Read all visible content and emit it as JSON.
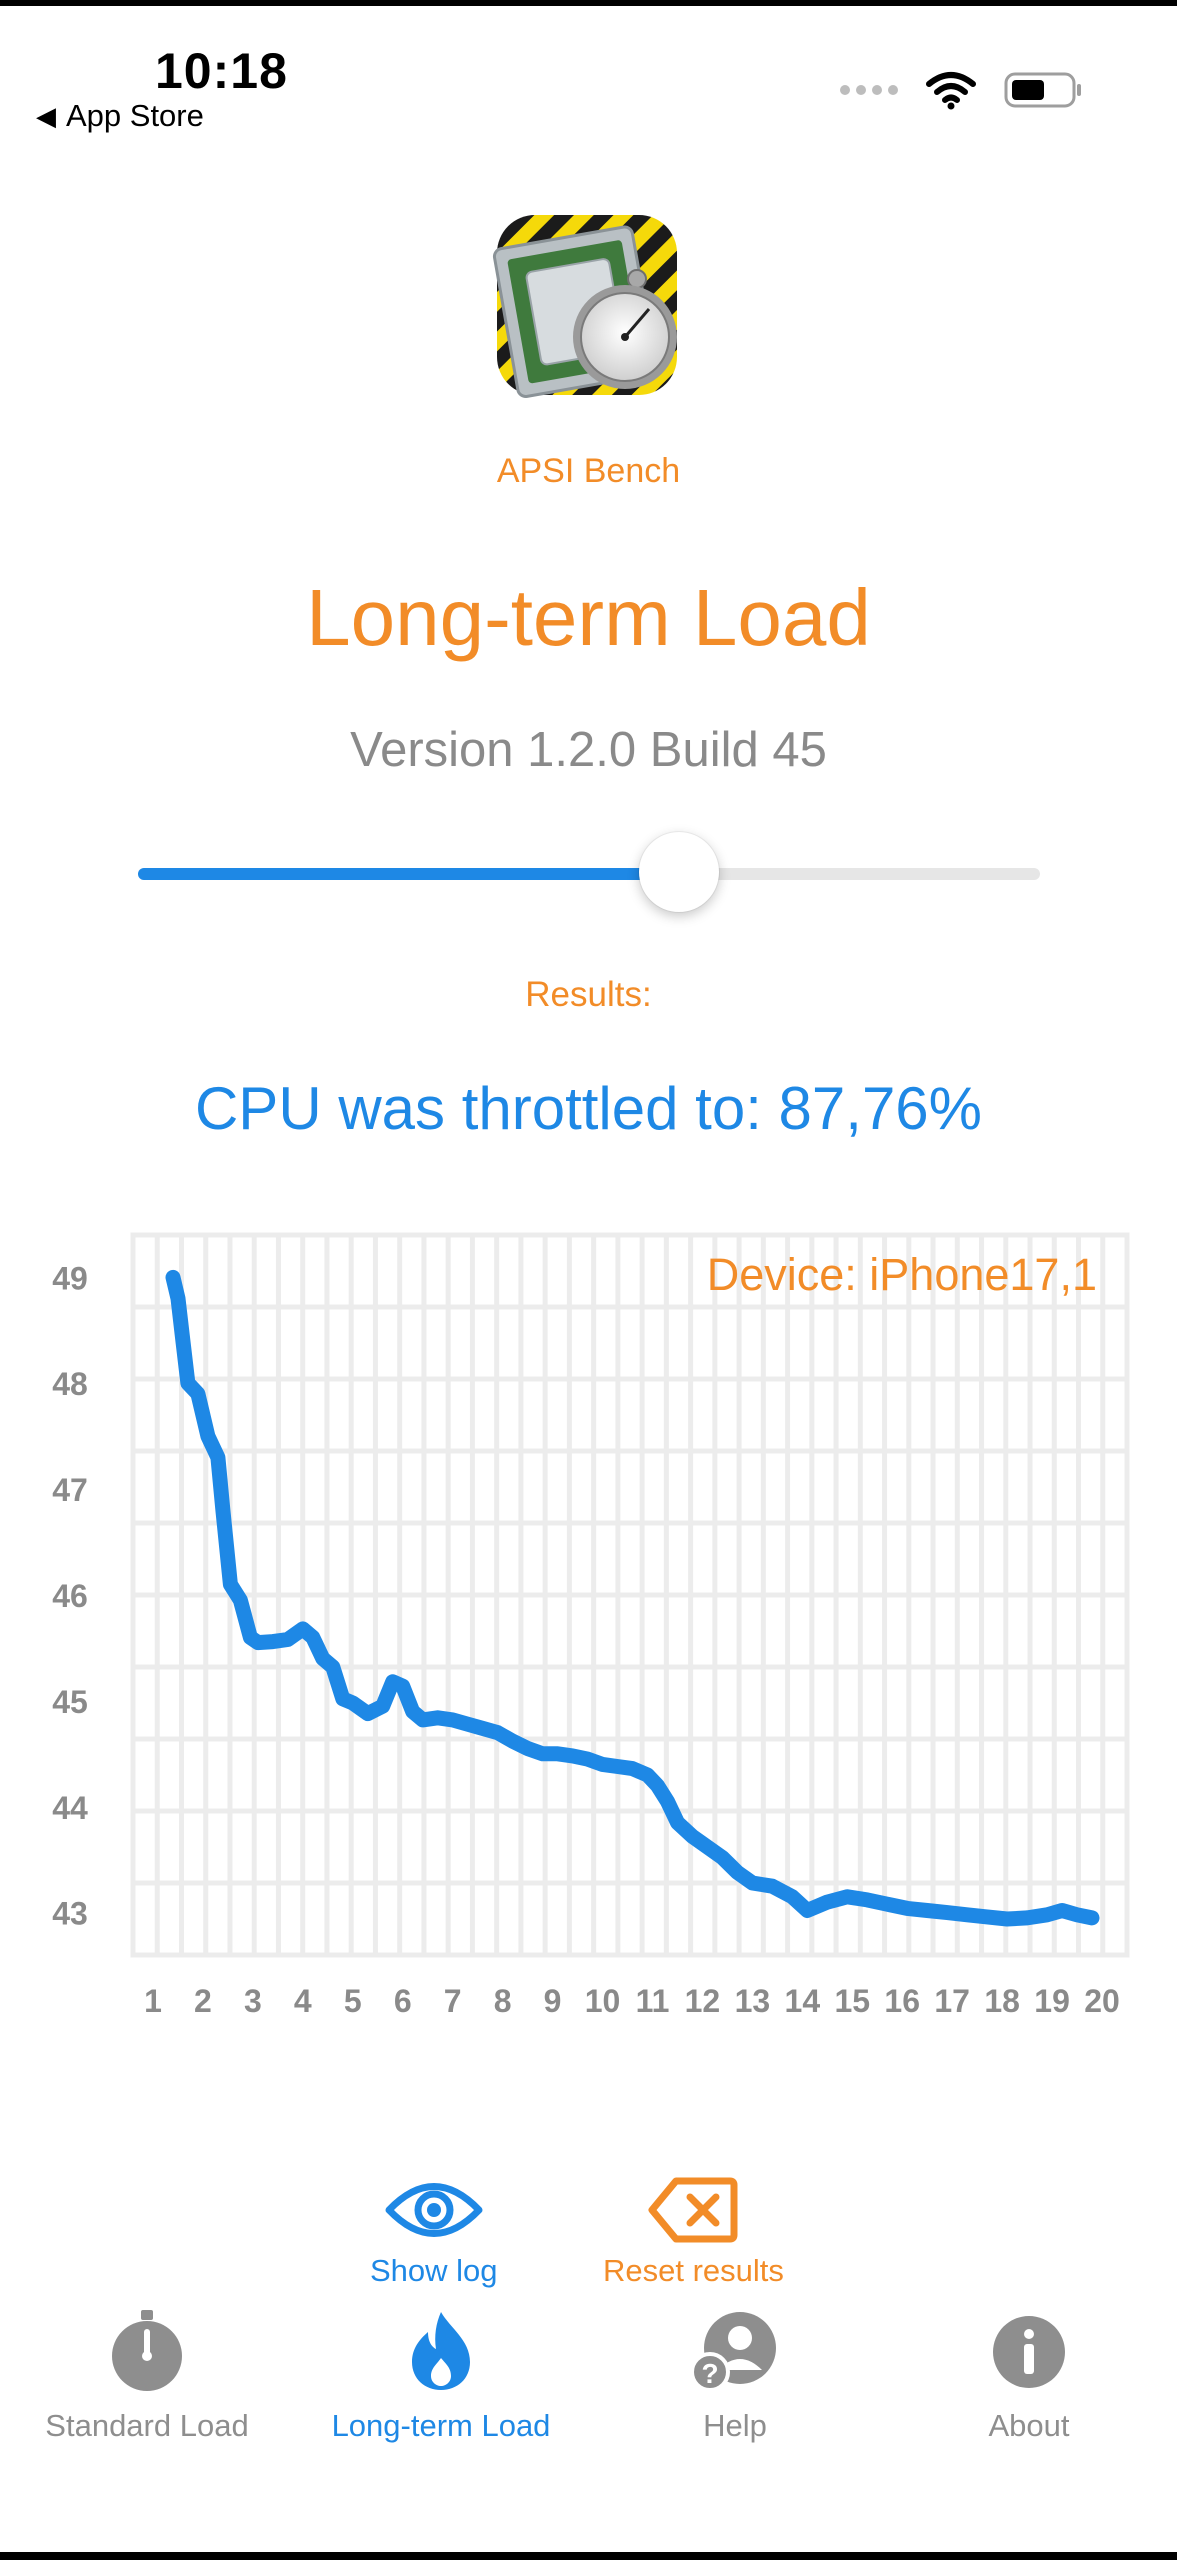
{
  "status": {
    "time": "10:18",
    "back_label": "App Store"
  },
  "app": {
    "name": "APSI Bench"
  },
  "page": {
    "title": "Long-term Load",
    "version": "Version 1.2.0 Build 45"
  },
  "slider": {
    "fraction": 0.6
  },
  "results": {
    "label": "Results:",
    "throttle_text": "CPU was throttled to: 87,76%"
  },
  "chart_data": {
    "type": "line",
    "annotation": "Device: iPhone17,1",
    "x_ticks": [
      "1",
      "2",
      "3",
      "4",
      "5",
      "6",
      "7",
      "8",
      "9",
      "10",
      "11",
      "12",
      "13",
      "14",
      "15",
      "16",
      "17",
      "18",
      "19",
      "20"
    ],
    "y_ticks": [
      "49",
      "48",
      "47",
      "46",
      "45",
      "44",
      "43"
    ],
    "xlim": [
      0.6,
      20.5
    ],
    "ylim": [
      42.6,
      49.4
    ],
    "grid": true,
    "line_color": "#1E88E5",
    "points": [
      [
        1.4,
        49.0
      ],
      [
        1.5,
        48.8
      ],
      [
        1.6,
        48.4
      ],
      [
        1.7,
        48.0
      ],
      [
        1.9,
        47.9
      ],
      [
        2.1,
        47.5
      ],
      [
        2.3,
        47.3
      ],
      [
        2.4,
        46.8
      ],
      [
        2.55,
        46.1
      ],
      [
        2.75,
        45.95
      ],
      [
        2.95,
        45.6
      ],
      [
        3.1,
        45.55
      ],
      [
        3.4,
        45.56
      ],
      [
        3.7,
        45.58
      ],
      [
        4.0,
        45.68
      ],
      [
        4.2,
        45.6
      ],
      [
        4.4,
        45.4
      ],
      [
        4.6,
        45.32
      ],
      [
        4.8,
        45.02
      ],
      [
        5.0,
        44.98
      ],
      [
        5.3,
        44.88
      ],
      [
        5.6,
        44.95
      ],
      [
        5.8,
        45.18
      ],
      [
        6.0,
        45.14
      ],
      [
        6.2,
        44.9
      ],
      [
        6.4,
        44.82
      ],
      [
        6.7,
        44.84
      ],
      [
        7.0,
        44.82
      ],
      [
        7.3,
        44.78
      ],
      [
        7.6,
        44.74
      ],
      [
        7.9,
        44.7
      ],
      [
        8.2,
        44.62
      ],
      [
        8.5,
        44.55
      ],
      [
        8.8,
        44.5
      ],
      [
        9.1,
        44.5
      ],
      [
        9.4,
        44.48
      ],
      [
        9.7,
        44.45
      ],
      [
        10.0,
        44.4
      ],
      [
        10.3,
        44.38
      ],
      [
        10.6,
        44.36
      ],
      [
        10.9,
        44.3
      ],
      [
        11.1,
        44.2
      ],
      [
        11.3,
        44.05
      ],
      [
        11.5,
        43.85
      ],
      [
        11.8,
        43.72
      ],
      [
        12.1,
        43.62
      ],
      [
        12.4,
        43.52
      ],
      [
        12.7,
        43.38
      ],
      [
        13.0,
        43.28
      ],
      [
        13.4,
        43.25
      ],
      [
        13.8,
        43.15
      ],
      [
        14.1,
        43.02
      ],
      [
        14.5,
        43.1
      ],
      [
        14.9,
        43.15
      ],
      [
        15.3,
        43.12
      ],
      [
        15.7,
        43.08
      ],
      [
        16.1,
        43.04
      ],
      [
        16.5,
        43.02
      ],
      [
        16.9,
        43.0
      ],
      [
        17.3,
        42.98
      ],
      [
        17.7,
        42.96
      ],
      [
        18.1,
        42.94
      ],
      [
        18.5,
        42.95
      ],
      [
        18.9,
        42.98
      ],
      [
        19.2,
        43.02
      ],
      [
        19.5,
        42.98
      ],
      [
        19.8,
        42.95
      ]
    ]
  },
  "actions": {
    "show_log": "Show log",
    "reset_results": "Reset results"
  },
  "colors": {
    "accent_orange": "#F28C28",
    "accent_blue": "#1E88E5",
    "inactive_gray": "#8e8e8e"
  },
  "tabbar": {
    "tabs": [
      {
        "label": "Standard Load",
        "icon": "stopwatch-icon",
        "active": false
      },
      {
        "label": "Long-term Load",
        "icon": "flame-icon",
        "active": true
      },
      {
        "label": "Help",
        "icon": "person-question-icon",
        "active": false
      },
      {
        "label": "About",
        "icon": "info-icon",
        "active": false
      }
    ]
  }
}
